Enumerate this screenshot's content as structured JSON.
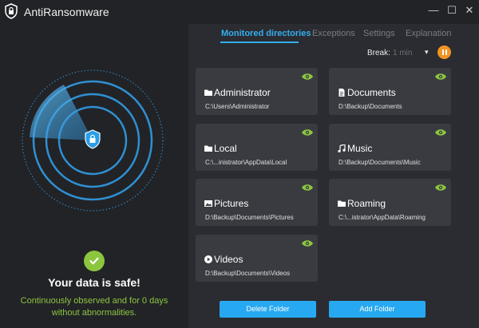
{
  "app": {
    "title": "AntiRansomware"
  },
  "window_controls": {
    "minimize": "—",
    "maximize": "☐",
    "close": "✕"
  },
  "status": {
    "title": "Your data is safe!",
    "subtitle_line1": "Continuously observed and for 0 days",
    "subtitle_line2": "without abnormalities."
  },
  "tabs": [
    {
      "label": "Monitored directories",
      "active": true
    },
    {
      "label": "Exceptions",
      "active": false
    },
    {
      "label": "Settings",
      "active": false
    },
    {
      "label": "Explanation",
      "active": false
    }
  ],
  "break": {
    "label": "Break:",
    "value": "1 min",
    "caret": "▾"
  },
  "folders": [
    {
      "name": "Administrator",
      "path": "C:\\Users\\Administrator",
      "icon": "folder-icon"
    },
    {
      "name": "Documents",
      "path": "D:\\Backup\\Documents",
      "icon": "document-icon"
    },
    {
      "name": "Local",
      "path": "C:\\...inistrator\\AppData\\Local",
      "icon": "folder-icon"
    },
    {
      "name": "Music",
      "path": "D:\\Backup\\Documents\\Music",
      "icon": "music-icon"
    },
    {
      "name": "Pictures",
      "path": "D:\\Backup\\Documents\\Pictures",
      "icon": "picture-icon"
    },
    {
      "name": "Roaming",
      "path": "C:\\...istrator\\AppData\\Roaming",
      "icon": "folder-icon"
    },
    {
      "name": "Videos",
      "path": "D:\\Backup\\Documents\\Videos",
      "icon": "video-icon"
    }
  ],
  "actions": {
    "delete_label": "Delete Folder",
    "add_label": "Add Folder"
  },
  "colors": {
    "accent": "#34aef0",
    "safe_green": "#8cc63f",
    "pause_orange": "#f29422",
    "eye_green": "#8cc63f"
  }
}
